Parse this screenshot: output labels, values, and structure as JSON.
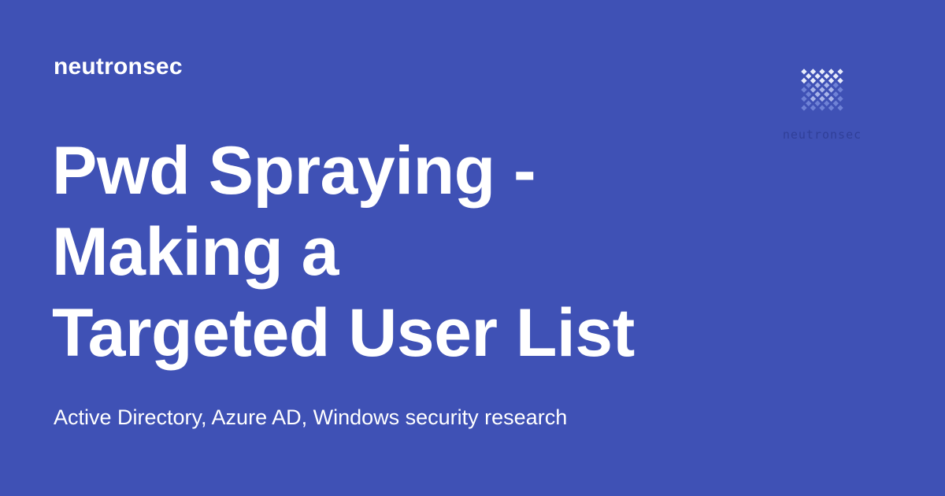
{
  "header": {
    "site_name": "neutronsec"
  },
  "article": {
    "title_lines": [
      "Pwd Spraying -",
      "Making a",
      "Targeted User List"
    ],
    "subtitle": "Active Directory, Azure AD, Windows security research"
  },
  "logo": {
    "icon": "diamond-grid-logo-icon",
    "caption": "neutronsec"
  },
  "colors": {
    "background": "#3f51b5",
    "text": "#ffffff",
    "logo_light": "#e8ecfb",
    "logo_mid": "#a9b5ea",
    "logo_dark": "#6f82d6"
  }
}
